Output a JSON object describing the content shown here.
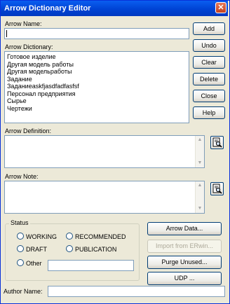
{
  "window": {
    "title": "Arrow Dictionary Editor",
    "close_glyph": "✕"
  },
  "arrow_name": {
    "label": "Arrow Name:",
    "value": ""
  },
  "dictionary": {
    "label": "Arrow Dictionary:",
    "items": [
      "Готовое изделие",
      "Другая модель работы",
      "Другая модельработы",
      "Задание",
      "Заданиеaskfjasdfadfasfsf",
      "Персонал предприятия",
      "Сырье",
      "Чертежи"
    ]
  },
  "buttons": {
    "add": "Add",
    "undo": "Undo",
    "clear": "Clear",
    "delete": "Delete",
    "close": "Close",
    "help": "Help",
    "arrow_data": "Arrow Data...",
    "import_erwin": "Import from ERwin...",
    "purge_unused": "Purge Unused...",
    "udp": "UDP ..."
  },
  "definition": {
    "label": "Arrow Definition:",
    "value": ""
  },
  "note": {
    "label": "Arrow Note:",
    "value": ""
  },
  "status": {
    "label": "Status",
    "options": [
      "WORKING",
      "RECOMMENDED",
      "DRAFT",
      "PUBLICATION",
      "Other"
    ],
    "other_value": ""
  },
  "author": {
    "label": "Author Name:",
    "value": ""
  },
  "icons": {
    "scroll_up": "▲",
    "scroll_down": "▼"
  }
}
